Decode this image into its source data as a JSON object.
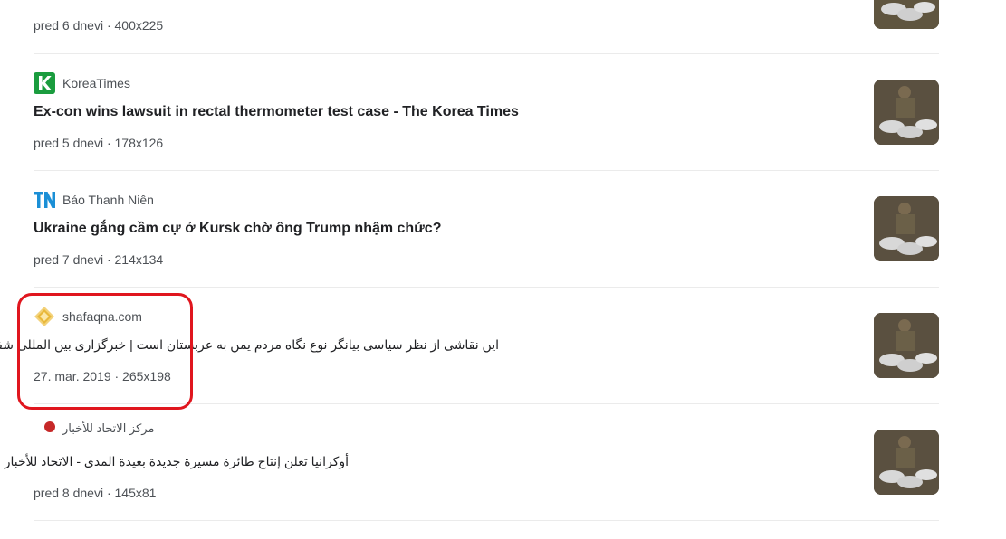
{
  "results": [
    {
      "meta": "pred 6 dnevi · 400x225"
    },
    {
      "source": "KoreaTimes",
      "title": "Ex-con wins lawsuit in rectal thermometer test case - The Korea Times",
      "meta": "pred 5 dnevi · 178x126"
    },
    {
      "source": "Báo Thanh Niên",
      "title": "Ukraine gắng cầm cự ở Kursk chờ ông Trump nhậm chức?",
      "meta": "pred 7 dnevi · 214x134"
    },
    {
      "source": "shafaqna.com",
      "title": "این نقاشی از نظر سیاسی بیانگر نوع نگاه مردم یمن به عربستان است | خبرگزاری بین المللی شفقنا",
      "meta": "27. mar. 2019 · 265x198"
    },
    {
      "source": "مركز الاتحاد للأخبار",
      "title": "أوكرانيا تعلن إنتاج طائرة مسيرة جديدة بعيدة المدى - الاتحاد للأخبار",
      "meta": "pred 8 dnevi · 145x81"
    }
  ],
  "colors": {
    "highlight": "#e0161e",
    "korea_green": "#1a9c3e",
    "thanhnien_blue": "#1b8fd6",
    "shafaqna_gold": "#e8b83a",
    "ittihad_red": "#c62828"
  }
}
